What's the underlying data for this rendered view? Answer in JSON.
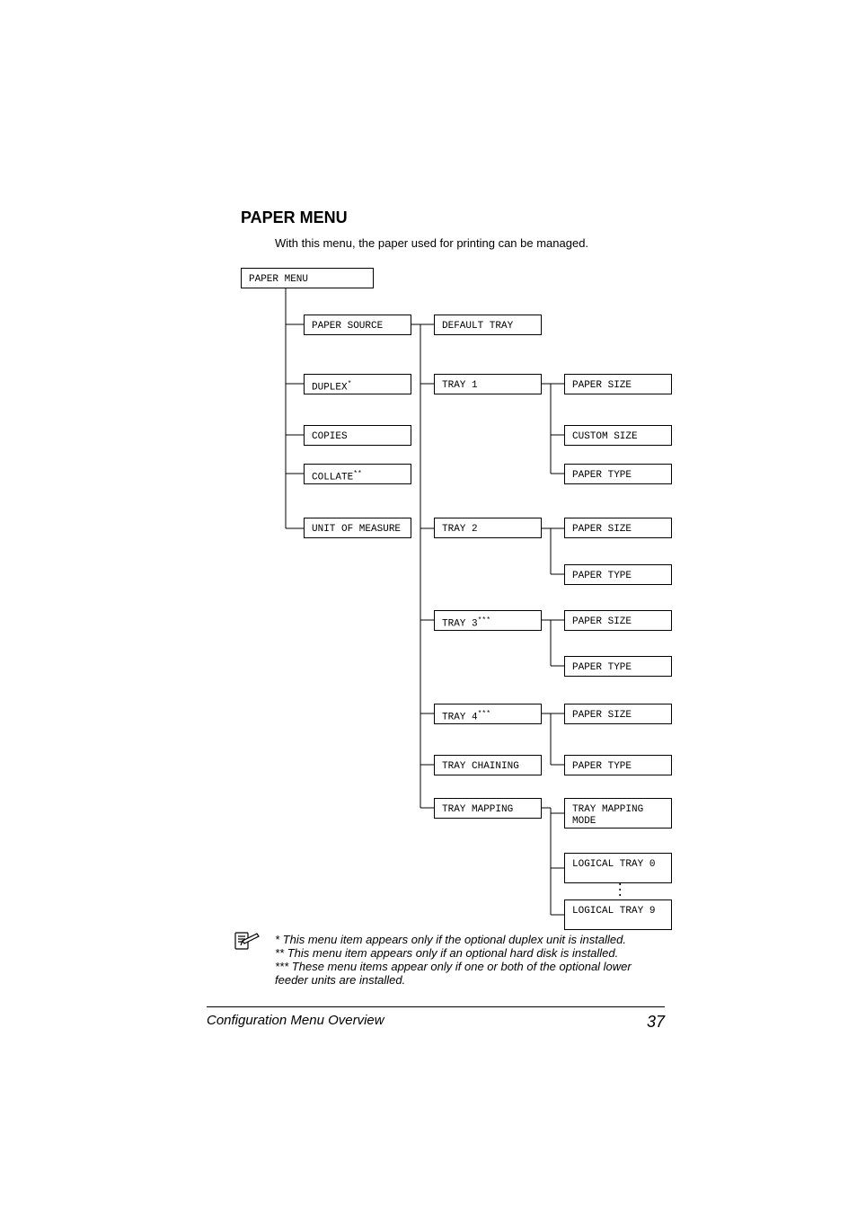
{
  "heading": "PAPER MENU",
  "intro": "With this menu, the paper used for printing can be managed.",
  "boxes": {
    "root": "PAPER MENU",
    "col1": {
      "paper_source": "PAPER SOURCE",
      "duplex": "DUPLEX",
      "duplex_sup": "*",
      "copies": "COPIES",
      "collate": "COLLATE",
      "collate_sup": "**",
      "unit": "UNIT OF MEASURE"
    },
    "col2": {
      "default_tray": "DEFAULT TRAY",
      "tray1": "TRAY 1",
      "tray2": "TRAY 2",
      "tray3": "TRAY 3",
      "tray3_sup": "***",
      "tray4": "TRAY 4",
      "tray4_sup": "***",
      "tray_chaining": "TRAY CHAINING",
      "tray_mapping": "TRAY MAPPING"
    },
    "col3": {
      "paper_size": "PAPER SIZE",
      "custom_size": "CUSTOM SIZE",
      "paper_type": "PAPER TYPE",
      "tray_mapping_mode": "TRAY MAPPING MODE",
      "logical_tray_0": "LOGICAL TRAY 0",
      "logical_tray_9": "LOGICAL TRAY 9"
    }
  },
  "footnotes": {
    "l1": "* This menu item appears only if the optional duplex unit is installed.",
    "l2": "** This menu item appears only if an optional hard disk is installed.",
    "l3": "*** These menu items appear only if one or both of the optional lower feeder units are installed."
  },
  "footer": {
    "title": "Configuration Menu Overview",
    "page": "37"
  }
}
